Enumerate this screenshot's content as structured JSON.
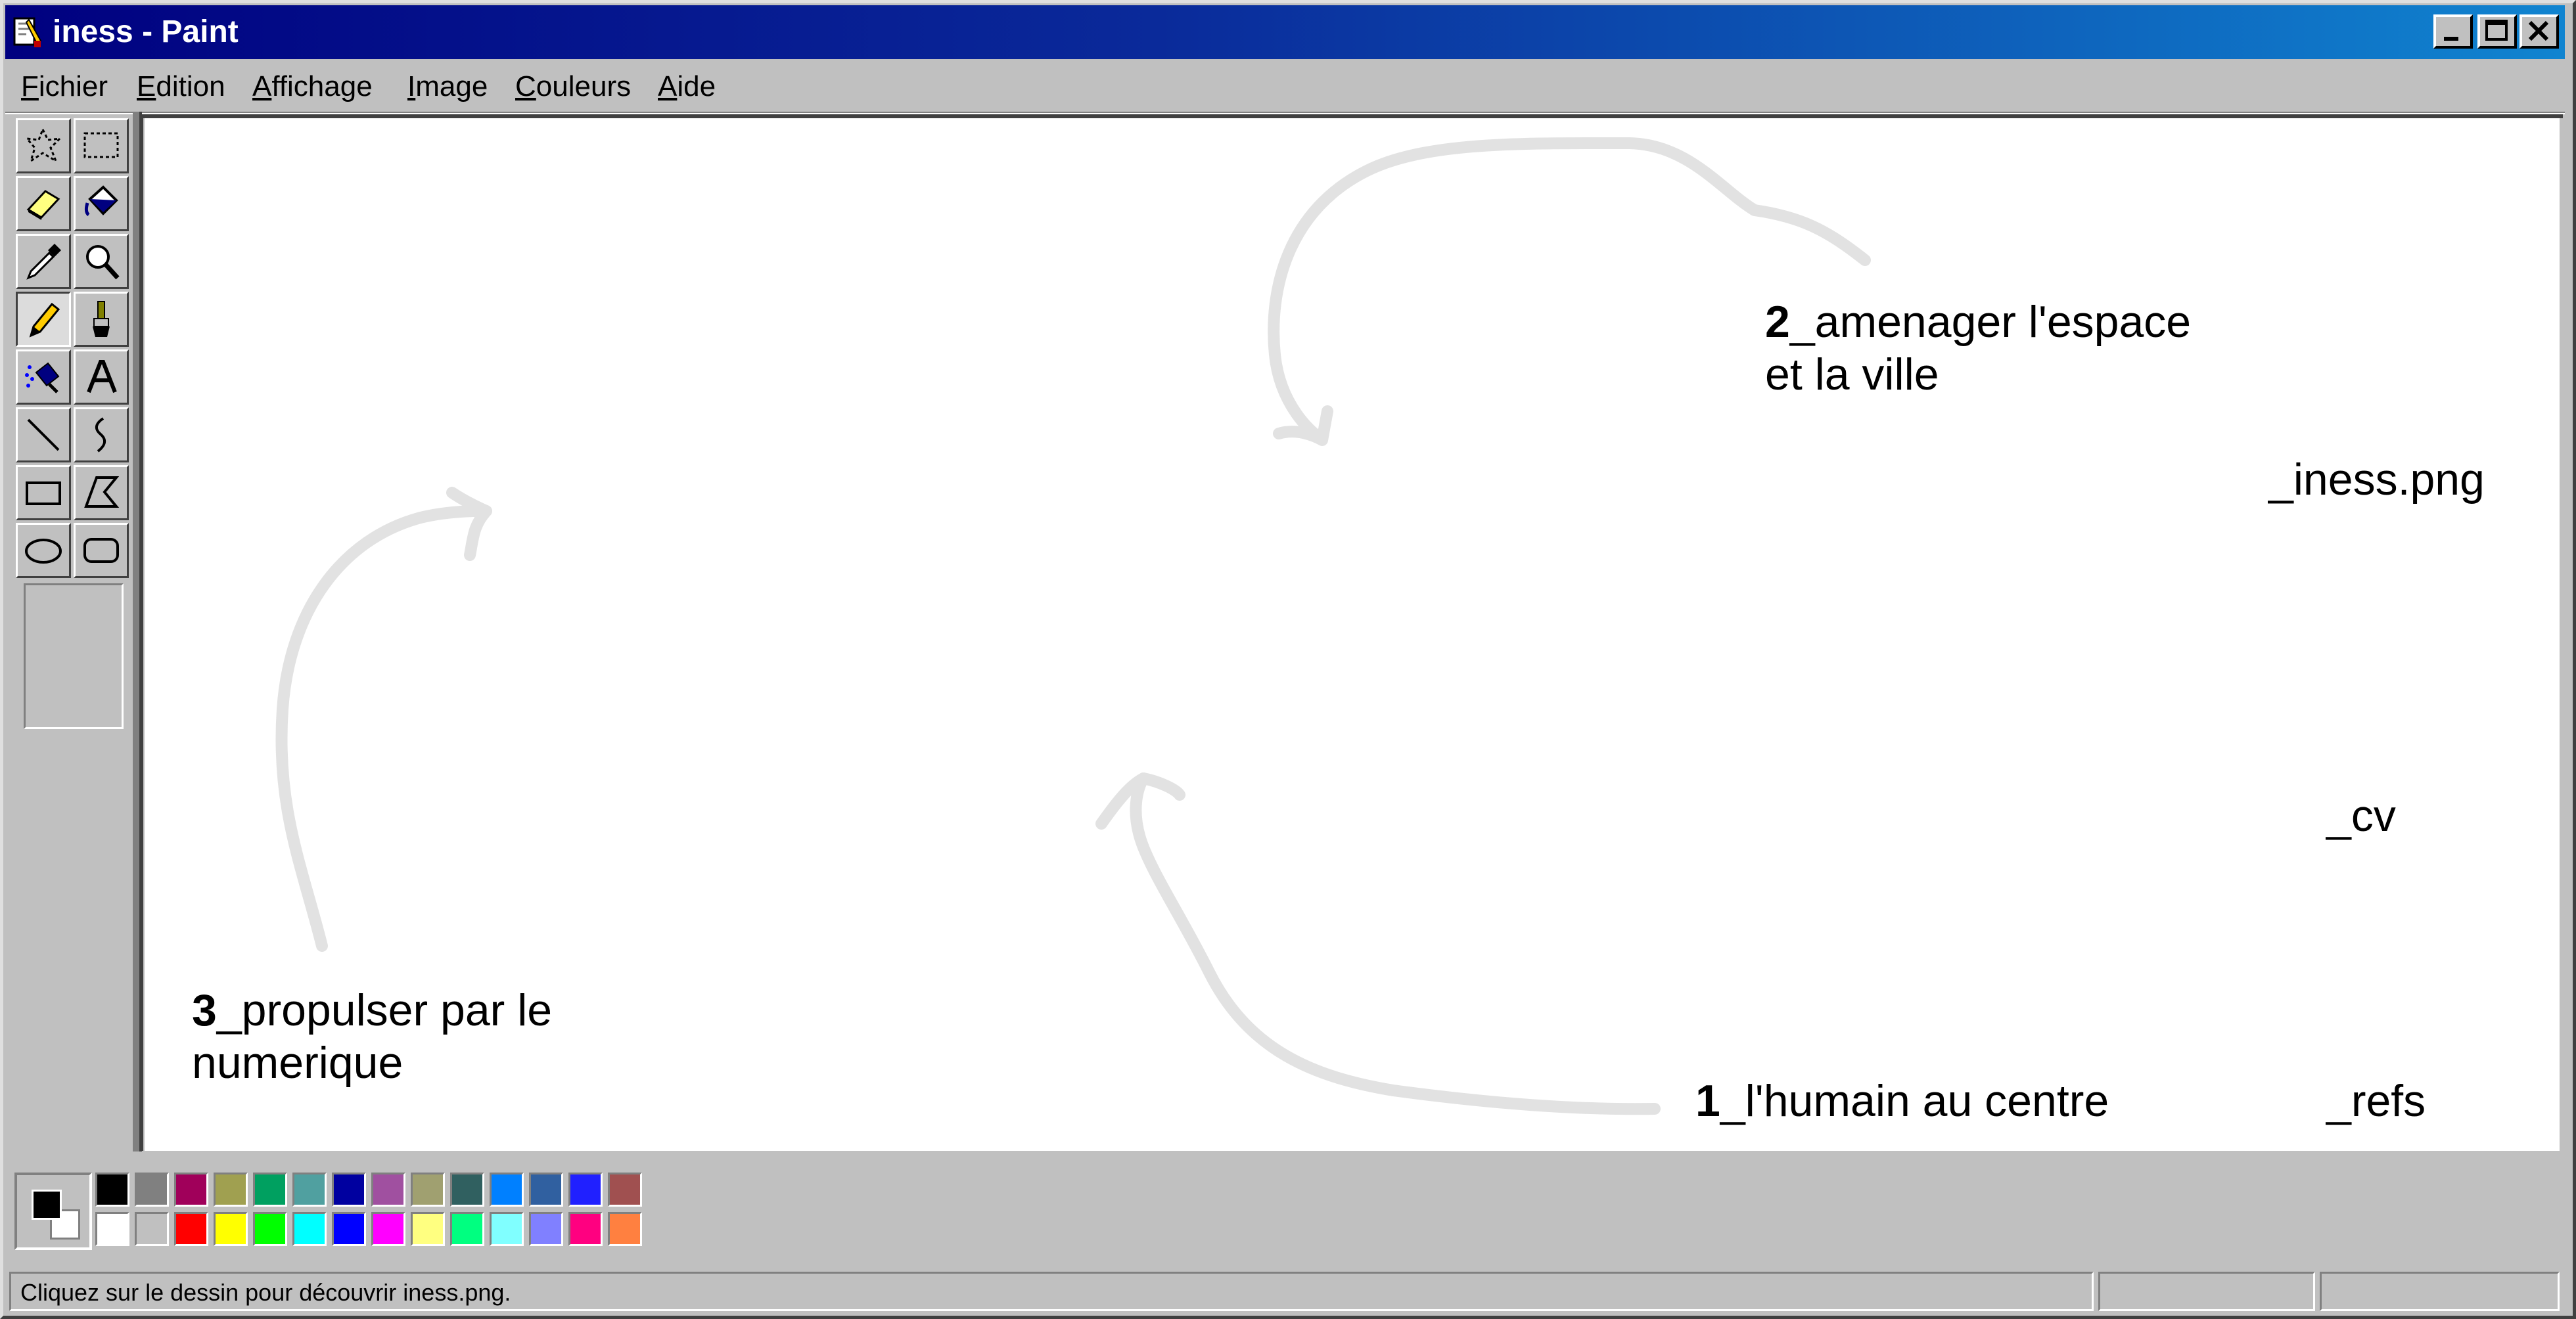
{
  "window": {
    "title": "iness - Paint"
  },
  "menu": [
    {
      "label": "Fichier"
    },
    {
      "label": "Edition"
    },
    {
      "label": "Affichage"
    },
    {
      "label": "Image"
    },
    {
      "label": "Couleurs"
    },
    {
      "label": "Aide"
    }
  ],
  "tools": [
    {
      "name": "free-form-select",
      "icon": "free-select-icon"
    },
    {
      "name": "select",
      "icon": "rect-select-icon"
    },
    {
      "name": "eraser",
      "icon": "eraser-icon"
    },
    {
      "name": "fill",
      "icon": "fill-bucket-icon"
    },
    {
      "name": "pick-color",
      "icon": "color-picker-icon"
    },
    {
      "name": "magnifier",
      "icon": "magnifier-icon"
    },
    {
      "name": "pencil",
      "icon": "pencil-icon",
      "selected": true
    },
    {
      "name": "brush",
      "icon": "brush-icon"
    },
    {
      "name": "airbrush",
      "icon": "airbrush-icon"
    },
    {
      "name": "text",
      "icon": "text-icon"
    },
    {
      "name": "line",
      "icon": "line-icon"
    },
    {
      "name": "curve",
      "icon": "curve-icon"
    },
    {
      "name": "rectangle",
      "icon": "rectangle-icon"
    },
    {
      "name": "polygon",
      "icon": "polygon-icon"
    },
    {
      "name": "ellipse",
      "icon": "ellipse-icon"
    },
    {
      "name": "rounded-rectangle",
      "icon": "rounded-rect-icon"
    }
  ],
  "canvas": {
    "label2": {
      "num": "2",
      "line1": "_amenager l'espace",
      "line2": "et la ville"
    },
    "label3": {
      "num": "3",
      "line1": "_propulser par le",
      "line2": "numerique"
    },
    "label1": {
      "num": "1",
      "text": "_l'humain au centre"
    },
    "link_iness": "_iness.png",
    "link_cv": "_cv",
    "link_refs": "_refs"
  },
  "palette": {
    "foreground": "#000000",
    "background": "#ffffff",
    "row1": [
      "#000000",
      "#808080",
      "#a0005a",
      "#a0a050",
      "#00a060",
      "#50a0a0",
      "#0000a0",
      "#a050a0",
      "#a0a070",
      "#306060",
      "#0080ff",
      "#3060a0",
      "#2020ff",
      "#a05050"
    ],
    "row2": [
      "#ffffff",
      "#c0c0c0",
      "#ff0000",
      "#ffff00",
      "#00ff00",
      "#00ffff",
      "#0000ff",
      "#ff00ff",
      "#ffff80",
      "#00ff80",
      "#80ffff",
      "#8080ff",
      "#ff0080",
      "#ff8040"
    ]
  },
  "status": {
    "text": "Cliquez sur le dessin pour découvrir iness.png."
  }
}
